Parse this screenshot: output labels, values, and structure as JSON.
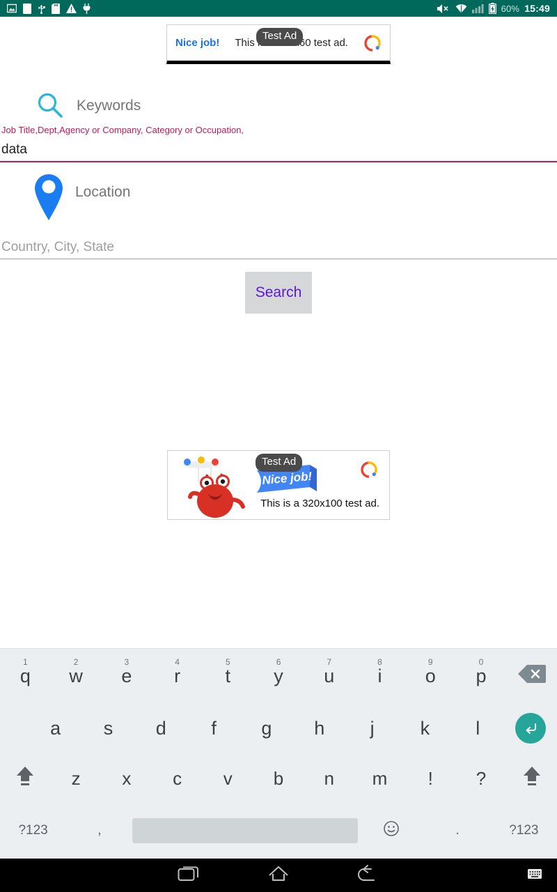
{
  "statusbar": {
    "icons": [
      "image-icon",
      "sd-card-blank-icon",
      "usb-icon",
      "sd-card-icon",
      "warning-icon",
      "plug-icon"
    ],
    "mute_icon": "volume-mute-icon",
    "wifi_icon": "wifi-icon",
    "signal_icon": "cell-signal-icon",
    "battery_icon": "battery-charging-icon",
    "battery_text": "60%",
    "time": "15:49"
  },
  "ad_top": {
    "badge": "Test Ad",
    "cta": "Nice job!",
    "body": "This is a 468x60 test ad.",
    "logo": "admob-logo",
    "size": "468x60"
  },
  "ad_bottom": {
    "badge": "Test Ad",
    "ribbon": "Nice job!",
    "caption": "This is a 320x100 test ad.",
    "logo": "admob-logo",
    "size": "320x100"
  },
  "form": {
    "keywords": {
      "icon": "search-icon",
      "label": "Keywords",
      "hint": "Job Title,Dept,Agency or Company, Category or Occupation,",
      "value": "data",
      "placeholder": ""
    },
    "location": {
      "icon": "map-pin-icon",
      "label": "Location",
      "value": "",
      "placeholder": "Country, City, State"
    },
    "search_button": "Search"
  },
  "colors": {
    "statusbar_bg": "#00695c",
    "accent_pink": "#c2185b",
    "search_icon": "#29b6d8",
    "pin_icon": "#1a7ef2",
    "search_text": "#5b16d6",
    "enter_key": "#26a69a",
    "keyboard_bg": "#eceff1"
  },
  "keyboard": {
    "row1": [
      {
        "key": "q",
        "num": "1"
      },
      {
        "key": "w",
        "num": "2"
      },
      {
        "key": "e",
        "num": "3"
      },
      {
        "key": "r",
        "num": "4"
      },
      {
        "key": "t",
        "num": "5"
      },
      {
        "key": "y",
        "num": "6"
      },
      {
        "key": "u",
        "num": "7"
      },
      {
        "key": "i",
        "num": "8"
      },
      {
        "key": "o",
        "num": "9"
      },
      {
        "key": "p",
        "num": "0"
      }
    ],
    "backspace": "backspace-icon",
    "row2": [
      "a",
      "s",
      "d",
      "f",
      "g",
      "h",
      "j",
      "k",
      "l"
    ],
    "enter": "enter-icon",
    "row3_shift_left": "shift-icon",
    "row3": [
      "z",
      "x",
      "c",
      "v",
      "b",
      "n",
      "m",
      "!",
      "?"
    ],
    "row3_shift_right": "shift-icon",
    "row4": {
      "symbols_left": "?123",
      "comma": ",",
      "space": "",
      "emoji": "emoji-icon",
      "period": ".",
      "symbols_right": "?123"
    }
  },
  "navbar": {
    "recents": "recents-icon",
    "home": "home-icon",
    "back": "back-icon",
    "keyboard": "keyboard-icon"
  }
}
